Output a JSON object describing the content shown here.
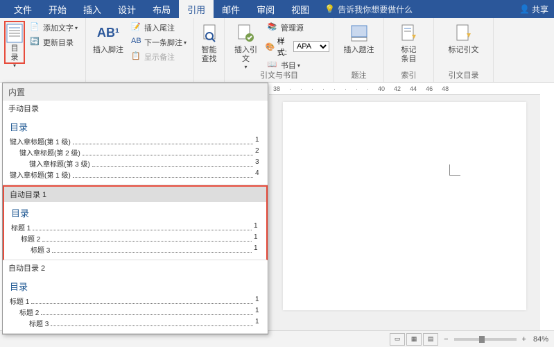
{
  "titlebar": {
    "tabs": [
      "文件",
      "开始",
      "插入",
      "设计",
      "布局",
      "引用",
      "邮件",
      "审阅",
      "视图"
    ],
    "active": 5,
    "tellme": "告诉我你想要做什么",
    "share": "共享"
  },
  "ribbon": {
    "toc": {
      "btn": "目录",
      "addText": "添加文字",
      "update": "更新目录"
    },
    "footnotes": {
      "insertFn": "插入脚注",
      "big": "AB¹",
      "insertEn": "插入尾注",
      "nextFn": "下一条脚注",
      "showNotes": "显示备注"
    },
    "smart": {
      "label": "智能\n查找"
    },
    "citations": {
      "insert": "插入引文",
      "manage": "管理源",
      "styleLbl": "样式:",
      "styleVal": "APA",
      "biblio": "书目",
      "group": "引文与书目"
    },
    "captions": {
      "insert": "插入题注",
      "group": "题注"
    },
    "index": {
      "mark": "标记\n条目",
      "group": "索引"
    },
    "toa": {
      "mark": "标记引文",
      "group": "引文目录"
    }
  },
  "toc": {
    "builtin": "内置",
    "manual": "手动目录",
    "mTitle": "目录",
    "mLines": [
      {
        "t": "键入章标题(第 1 级)",
        "p": "1",
        "i": 0
      },
      {
        "t": "键入章标题(第 2 级)",
        "p": "2",
        "i": 1
      },
      {
        "t": "键入章标题(第 3 级)",
        "p": "3",
        "i": 2
      },
      {
        "t": "键入章标题(第 1 级)",
        "p": "4",
        "i": 0
      }
    ],
    "auto1": "自动目录 1",
    "a1Title": "目录",
    "a1Lines": [
      {
        "t": "标题 1",
        "p": "1",
        "i": 0
      },
      {
        "t": "标题 2",
        "p": "1",
        "i": 1
      },
      {
        "t": "标题 3",
        "p": "1",
        "i": 2
      }
    ],
    "auto2": "自动目录 2",
    "a2Title": "目录",
    "a2Lines": [
      {
        "t": "标题 1",
        "p": "1",
        "i": 0
      },
      {
        "t": "标题 2",
        "p": "1",
        "i": 1
      },
      {
        "t": "标题 3",
        "p": "1",
        "i": 2
      }
    ]
  },
  "ruler": [
    "38",
    "",
    "",
    "",
    "",
    "",
    "",
    "",
    "",
    "40",
    "42",
    "44",
    "46",
    "48"
  ],
  "zoom": "84%"
}
